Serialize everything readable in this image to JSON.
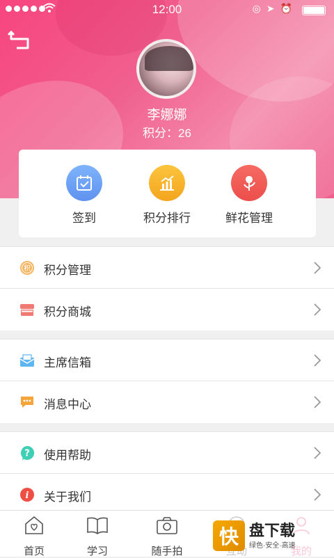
{
  "status": {
    "time": "12:00"
  },
  "profile": {
    "name": "李娜娜",
    "points_text": "积分：26"
  },
  "quick_actions": [
    {
      "label": "签到",
      "icon": "calendar-check-icon",
      "color": "#6ea6f5"
    },
    {
      "label": "积分排行",
      "icon": "bar-chart-icon",
      "color": "#f7b52a"
    },
    {
      "label": "鲜花管理",
      "icon": "rose-icon",
      "color": "#f2605a"
    }
  ],
  "menu_groups": [
    [
      {
        "label": "积分管理",
        "icon": "points-coin-icon"
      },
      {
        "label": "积分商城",
        "icon": "store-icon"
      }
    ],
    [
      {
        "label": "主席信箱",
        "icon": "mailbox-icon"
      },
      {
        "label": "消息中心",
        "icon": "message-icon"
      }
    ],
    [
      {
        "label": "使用帮助",
        "icon": "help-icon"
      },
      {
        "label": "关于我们",
        "icon": "info-icon"
      }
    ]
  ],
  "tabs": [
    {
      "label": "首页",
      "icon": "home-icon"
    },
    {
      "label": "学习",
      "icon": "book-icon"
    },
    {
      "label": "随手拍",
      "icon": "camera-icon"
    },
    {
      "label": "互动",
      "icon": "chat-icon"
    },
    {
      "label": "我的",
      "icon": "user-icon"
    }
  ],
  "watermark": {
    "logo_char": "快",
    "title": "盘下载",
    "subtitle": "绿色·安全·高速"
  },
  "colors": {
    "hero": "#f0608e",
    "accent": "#f7447f"
  }
}
